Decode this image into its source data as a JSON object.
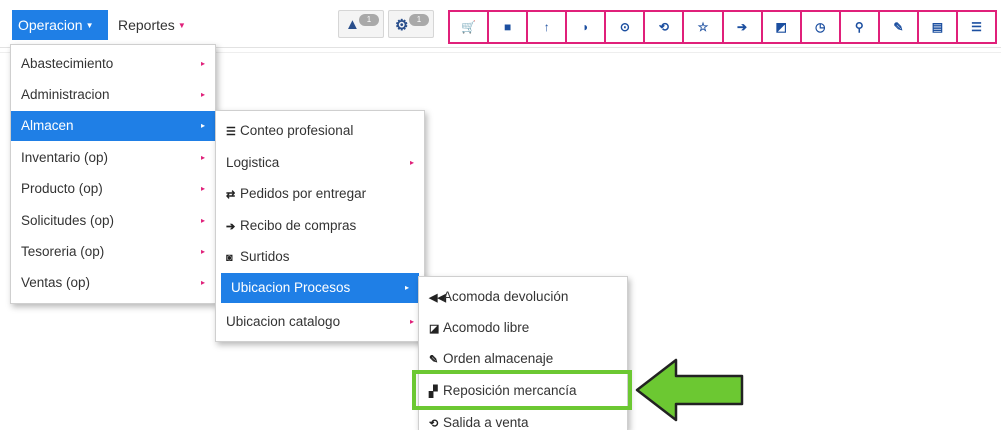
{
  "navbar": {
    "operacion_label": "Operacion",
    "reportes_label": "Reportes",
    "badge1_count": "1",
    "badge2_count": "1"
  },
  "toolbar": {
    "icons": [
      "cart-icon",
      "box-icon",
      "dolly-icon",
      "shield-icon",
      "check-circle-icon",
      "return-icon",
      "star-icon",
      "sign-in-icon",
      "export-icon",
      "clock-icon",
      "map-marker-icon",
      "edit-icon",
      "id-card-icon",
      "list-icon"
    ]
  },
  "menu_level1": {
    "items": [
      "Abastecimiento",
      "Administracion",
      "Almacen",
      "Inventario (op)",
      "Producto (op)",
      "Solicitudes (op)",
      "Tesoreria (op)",
      "Ventas (op)"
    ],
    "active_index": 2
  },
  "menu_level2": {
    "items": [
      "Conteo profesional",
      "Logistica",
      "Pedidos por entregar",
      "Recibo de compras",
      "Surtidos",
      "Ubicacion Procesos",
      "Ubicacion catalogo"
    ],
    "active_index": 5
  },
  "menu_level3": {
    "items": [
      "Acomoda devolución",
      "Acomodo libre",
      "Orden almacenaje",
      "Reposición mercancía",
      "Salida a venta"
    ],
    "highlighted_index": 3
  },
  "colors": {
    "accent_blue": "#1f7fe6",
    "toolbar_border": "#e0207a",
    "highlight_green": "#6cc832",
    "icon_blue": "#1c4fa0"
  }
}
